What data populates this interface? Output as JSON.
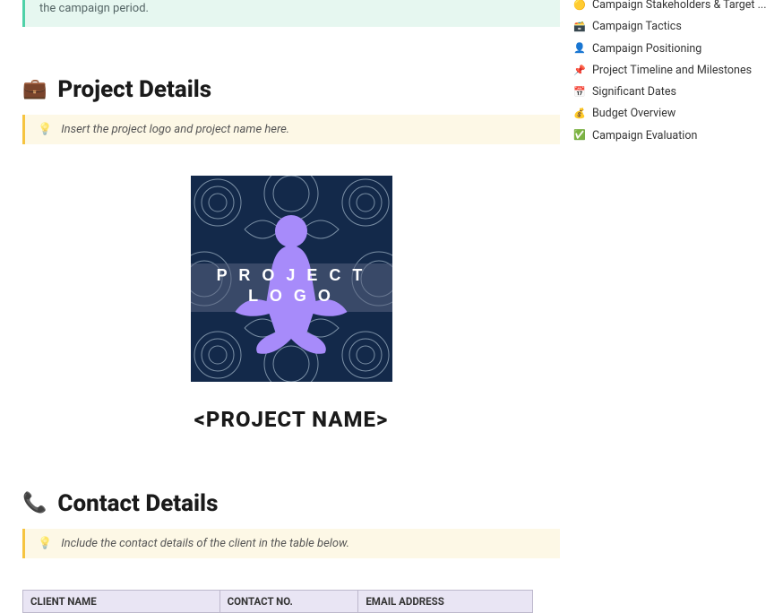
{
  "intro": {
    "text": "the campaign period."
  },
  "project_details": {
    "heading": "Project Details",
    "tip": "Insert the project logo and project name here.",
    "logo_line1": "P R O J E C T",
    "logo_line2": "L O G O",
    "name_placeholder": "<PROJECT NAME>"
  },
  "contact_details": {
    "heading": "Contact Details",
    "tip": "Include the contact details of the client in the table below.",
    "columns": [
      "CLIENT NAME",
      "CONTACT NO.",
      "EMAIL ADDRESS"
    ]
  },
  "sidebar": {
    "items": [
      {
        "icon": "🟡",
        "label": "Campaign Stakeholders & Target ..."
      },
      {
        "icon": "🗃️",
        "label": "Campaign Tactics"
      },
      {
        "icon": "👤",
        "label": "Campaign Positioning"
      },
      {
        "icon": "📌",
        "label": "Project Timeline and Milestones",
        "color": "#e03a3a"
      },
      {
        "icon": "📅",
        "label": "Significant Dates"
      },
      {
        "icon": "💰",
        "label": "Budget Overview"
      },
      {
        "icon": "✅",
        "label": "Campaign Evaluation",
        "color": "#1fbf6b"
      }
    ]
  }
}
